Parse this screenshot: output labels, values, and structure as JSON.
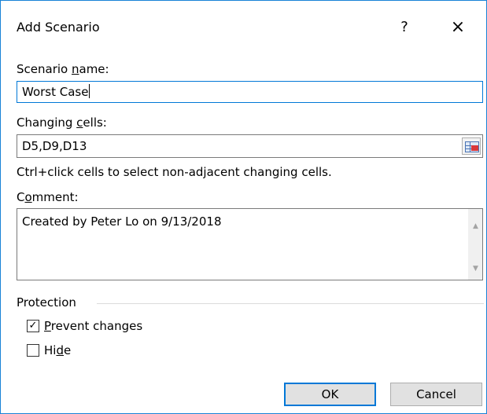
{
  "dialog": {
    "title": "Add Scenario",
    "help_label": "?",
    "close_label": "×"
  },
  "scenario_name": {
    "label_pre": "Scenario ",
    "label_key": "n",
    "label_post": "ame:",
    "value": "Worst Case"
  },
  "changing_cells": {
    "label_pre": "Changing ",
    "label_key": "c",
    "label_post": "ells:",
    "value": "D5,D9,D13",
    "hint": "Ctrl+click cells to select non-adjacent changing cells."
  },
  "comment": {
    "label_pre": "C",
    "label_key": "o",
    "label_post": "mment:",
    "value": "Created by Peter Lo on 9/13/2018"
  },
  "protection": {
    "heading": "Protection",
    "prevent_changes": {
      "label_key": "P",
      "label_post": "revent changes",
      "checked": true
    },
    "hide": {
      "label_pre": "Hi",
      "label_key": "d",
      "label_post": "e",
      "checked": false
    }
  },
  "buttons": {
    "ok": "OK",
    "cancel": "Cancel"
  },
  "icons": {
    "check": "✓",
    "scroll_up": "▲",
    "scroll_down": "▼"
  },
  "colors": {
    "accent": "#0078d7",
    "border": "#1883d7"
  }
}
